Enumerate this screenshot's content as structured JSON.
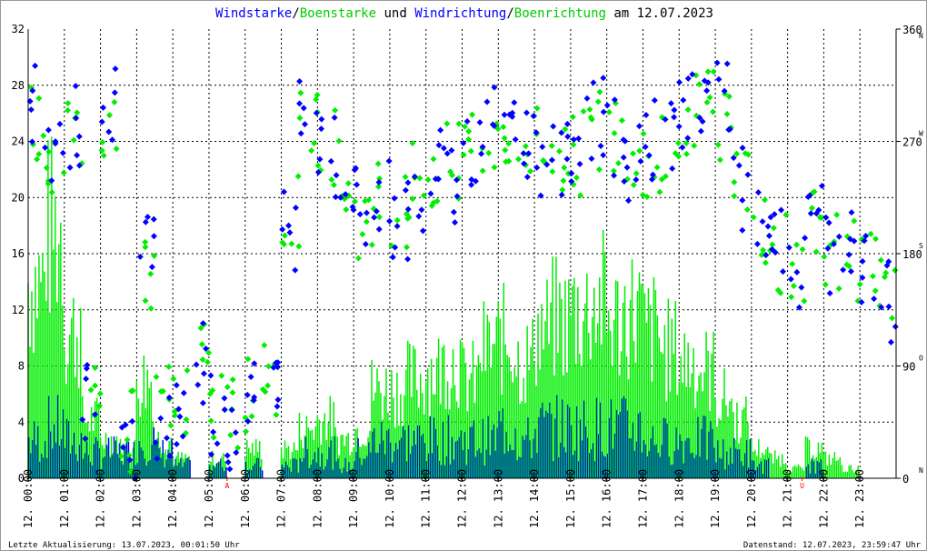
{
  "chart_data": {
    "type": "scatter",
    "title_parts": [
      {
        "text": "Windstarke",
        "color": "#0000ff"
      },
      {
        "text": "/",
        "color": "#000000"
      },
      {
        "text": "Boenstarke",
        "color": "#00cc00"
      },
      {
        "text": " und ",
        "color": "#000000"
      },
      {
        "text": "Windrichtung",
        "color": "#0000ff"
      },
      {
        "text": "/",
        "color": "#000000"
      },
      {
        "text": "Boenrichtung",
        "color": "#00cc00"
      },
      {
        "text": " am 12.07.2023",
        "color": "#000000"
      }
    ],
    "left_axis": {
      "ylim": [
        0,
        32
      ],
      "ticks": [
        "0",
        "4",
        "8",
        "12",
        "16",
        "20",
        "24",
        "28",
        "32"
      ]
    },
    "right_axis": {
      "ylim": [
        0,
        360
      ],
      "ticks": [
        "0",
        "90",
        "180",
        "270",
        "360"
      ],
      "compass": [
        "N",
        "O",
        "S",
        "W",
        "N"
      ]
    },
    "x_ticks": [
      "12. 00:00",
      "12. 01:00",
      "12. 02:00",
      "12. 03:00",
      "12. 04:00",
      "12. 05:00",
      "12. 06:00",
      "12. 07:00",
      "12. 08:00",
      "12. 09:00",
      "12. 10:00",
      "12. 11:00",
      "12. 12:00",
      "12. 13:00",
      "12. 14:00",
      "12. 15:00",
      "12. 16:00",
      "12. 17:00",
      "12. 18:00",
      "12. 19:00",
      "12. 20:00",
      "12. 21:00",
      "12. 22:00",
      "12. 23:00"
    ],
    "markers": [
      {
        "label": "A",
        "hour": 5.5
      },
      {
        "label": "U",
        "hour": 21.4
      }
    ],
    "x_hours": [
      0,
      0.5,
      1,
      1.5,
      2,
      2.5,
      3,
      3.5,
      4,
      4.5,
      5,
      5.5,
      6,
      6.5,
      7,
      7.5,
      8,
      8.5,
      9,
      9.5,
      10,
      10.5,
      11,
      11.5,
      12,
      12.5,
      13,
      13.5,
      14,
      14.5,
      15,
      15.5,
      16,
      16.5,
      17,
      17.5,
      18,
      18.5,
      19,
      19.5,
      20,
      20.5,
      21,
      21.5,
      22,
      22.5,
      23,
      23.5
    ],
    "series": [
      {
        "name": "Windstarke",
        "color": "#0000ff",
        "values": [
          3,
          4,
          3,
          2,
          2,
          2,
          3,
          2,
          1,
          0,
          1,
          0,
          1,
          0,
          1,
          2,
          2,
          1,
          2,
          3,
          3,
          3,
          3,
          3,
          3,
          3,
          4,
          3,
          4,
          4,
          4,
          4,
          4,
          4,
          3,
          3,
          3,
          3,
          2,
          2,
          1,
          0,
          0,
          1,
          0,
          0,
          0,
          0
        ]
      },
      {
        "name": "Boenstarke",
        "color": "#00ee00",
        "values": [
          20,
          25,
          15,
          6,
          4,
          3,
          10,
          4,
          2,
          0,
          2,
          0,
          3,
          0,
          3,
          5,
          6,
          4,
          5,
          9,
          9,
          10,
          11,
          12,
          10,
          13,
          14,
          12,
          15,
          16,
          17,
          18,
          16,
          17,
          15,
          13,
          12,
          11,
          8,
          6,
          3,
          2,
          1,
          3,
          2,
          1,
          0,
          0
        ]
      },
      {
        "name": "Windrichtung",
        "color": "#0000ff",
        "values": [
          300,
          250,
          280,
          60,
          300,
          30,
          180,
          50,
          60,
          90,
          50,
          40,
          60,
          70,
          200,
          300,
          280,
          230,
          220,
          230,
          210,
          230,
          250,
          240,
          260,
          280,
          290,
          270,
          260,
          250,
          270,
          290,
          270,
          250,
          270,
          280,
          300,
          290,
          300,
          230,
          200,
          180,
          170,
          220,
          180,
          180,
          165,
          140
        ]
      },
      {
        "name": "Boenrichtung",
        "color": "#00ee00",
        "values": [
          290,
          260,
          270,
          70,
          290,
          40,
          170,
          60,
          70,
          90,
          60,
          50,
          70,
          80,
          210,
          290,
          270,
          240,
          210,
          220,
          220,
          240,
          240,
          250,
          270,
          270,
          280,
          260,
          270,
          260,
          260,
          280,
          280,
          260,
          260,
          270,
          290,
          300,
          290,
          240,
          190,
          180,
          175,
          210,
          185,
          175,
          165,
          145
        ]
      }
    ],
    "footer_left": "Letzte Aktualisierung: 13.07.2023, 00:01:50 Uhr",
    "footer_right": "Datenstand: 12.07.2023, 23:59:47 Uhr"
  }
}
